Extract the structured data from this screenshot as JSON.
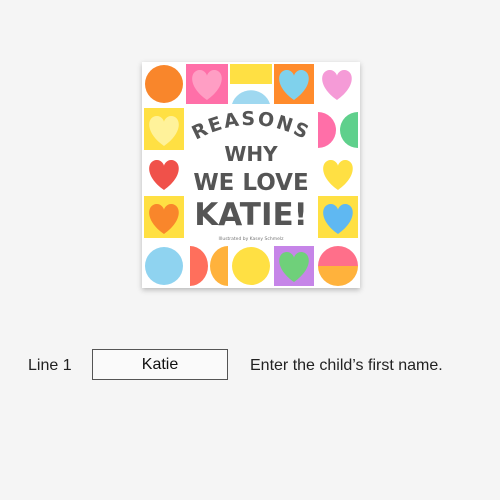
{
  "book": {
    "title_lines": [
      "REASONS",
      "WHY",
      "WE LOVE",
      "KATIE!"
    ],
    "byline": "Illustrated by Kasey Schmelz"
  },
  "form": {
    "line_label": "Line 1",
    "name_value": "Katie",
    "hint": "Enter the child’s first name."
  }
}
